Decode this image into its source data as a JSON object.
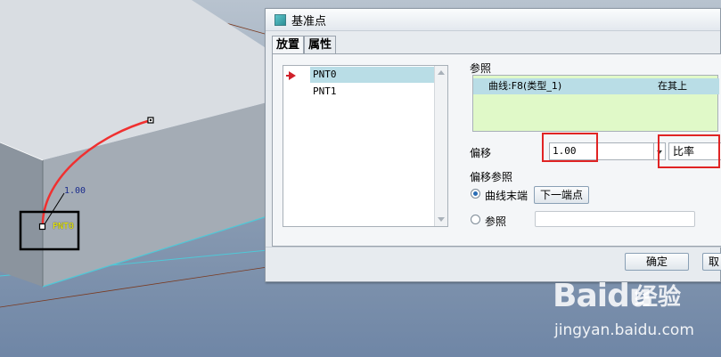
{
  "viewport": {
    "curve_start_label": "1.00",
    "point_label": "PNT0"
  },
  "dialog": {
    "title": "基准点",
    "tabs": [
      {
        "label": "放置",
        "active": true
      },
      {
        "label": "属性",
        "active": false
      }
    ],
    "points": [
      "PNT0",
      "PNT1"
    ],
    "selected_point": "PNT0",
    "references": {
      "label": "参照",
      "rows": [
        {
          "name": "曲线:F8(类型_1)",
          "constraint": "在其上"
        }
      ]
    },
    "offset": {
      "label": "偏移",
      "value": "1.00",
      "type": "比率"
    },
    "offset_reference": {
      "label": "偏移参照",
      "option_curve_end": "曲线末端",
      "next_end_button": "下一端点",
      "option_reference": "参照",
      "selected": "曲线末端"
    },
    "buttons": {
      "ok": "确定",
      "cancel": "取"
    }
  },
  "watermark": {
    "logo": "Baidu",
    "service": "经验",
    "url": "jingyan.baidu.com"
  },
  "colors": {
    "selection": "#b9dde6",
    "reference_box": "#e0f9c8",
    "highlight": "#e02424",
    "curve": "#f03030"
  }
}
